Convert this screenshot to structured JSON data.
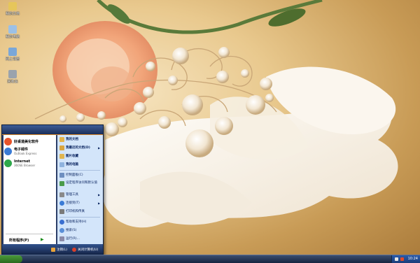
{
  "desktop": {
    "icons": [
      {
        "label": "我的文档",
        "icon": "documents-icon",
        "color": "#e6c65a"
      },
      {
        "label": "我的电脑",
        "icon": "computer-icon",
        "color": "#9cc0e6"
      },
      {
        "label": "网上邻居",
        "icon": "network-icon",
        "color": "#7aa7d8"
      },
      {
        "label": "回收站",
        "icon": "recycle-bin-icon",
        "color": "#9aa3ad"
      }
    ]
  },
  "start_menu": {
    "pinned": [
      {
        "title": "好桌道美化软件",
        "subtitle": "",
        "icon": "beautify-icon",
        "color": "#e8542a"
      },
      {
        "title": "电子邮件",
        "subtitle": "Outlook Express",
        "icon": "email-icon",
        "color": "#3a7bd5"
      },
      {
        "title": "Internet",
        "subtitle": "360SE Browser",
        "icon": "browser-icon",
        "color": "#2ea84a"
      }
    ],
    "all_programs": "所有程序(P)",
    "right_items": [
      {
        "label": "我的文档",
        "bold": true,
        "arrow": false,
        "icon": "my-documents-icon",
        "color": "#e3b44a"
      },
      {
        "label": "我最近的文档(D)",
        "bold": true,
        "arrow": true,
        "icon": "recent-documents-icon",
        "color": "#d9a53f"
      },
      {
        "label": "图片收藏",
        "bold": true,
        "arrow": false,
        "icon": "my-pictures-icon",
        "color": "#e0b550"
      },
      {
        "label": "我的电脑",
        "bold": true,
        "arrow": false,
        "icon": "my-computer-icon",
        "color": "#8fb3de"
      },
      {
        "label": "控制面板(C)",
        "bold": false,
        "arrow": false,
        "icon": "control-panel-icon",
        "color": "#6e8fc0"
      },
      {
        "label": "设定程序访问和默认值",
        "bold": false,
        "arrow": false,
        "icon": "program-defaults-icon",
        "color": "#4a9b4a"
      },
      {
        "label": "管理工具",
        "bold": false,
        "arrow": true,
        "icon": "admin-tools-icon",
        "color": "#8a8a8a"
      },
      {
        "label": "连接到(T)",
        "bold": false,
        "arrow": true,
        "icon": "connect-to-icon",
        "color": "#3a7bd5"
      },
      {
        "label": "打印机和传真",
        "bold": false,
        "arrow": false,
        "icon": "printers-icon",
        "color": "#7a7a7a"
      },
      {
        "label": "帮助和支持(H)",
        "bold": false,
        "arrow": false,
        "icon": "help-icon",
        "color": "#3a6fd0"
      },
      {
        "label": "搜索(S)",
        "bold": false,
        "arrow": false,
        "icon": "search-icon",
        "color": "#5a8fd8"
      },
      {
        "label": "运行(R)...",
        "bold": false,
        "arrow": false,
        "icon": "run-icon",
        "color": "#8a8aa8"
      }
    ],
    "footer": {
      "logoff": "注销(L)",
      "shutdown": "关闭计算机(U)"
    }
  },
  "taskbar": {
    "clock": "10:24"
  },
  "colors": {
    "logoff": "#e8a33a",
    "shutdown": "#d8402a",
    "tray1": "#e6e6e6",
    "tray2": "#e04a2a"
  }
}
